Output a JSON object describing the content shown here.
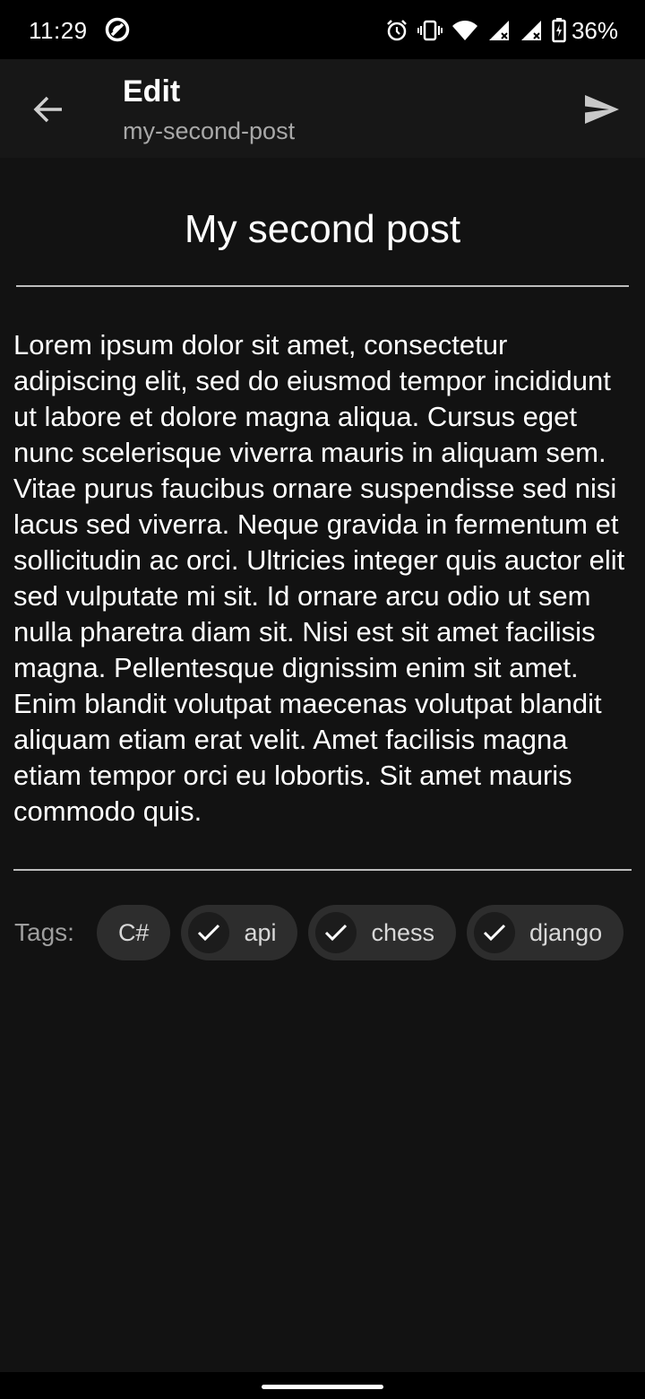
{
  "status_bar": {
    "time": "11:29",
    "battery": "36%",
    "icons": [
      "do-not-disturb-icon",
      "alarm-icon",
      "vibrate-icon",
      "wifi-icon",
      "signal-icon",
      "signal-icon",
      "battery-charging-icon"
    ]
  },
  "app_bar": {
    "title": "Edit",
    "subtitle": "my-second-post",
    "back_icon": "back-arrow-icon",
    "send_icon": "send-icon"
  },
  "post": {
    "title": "My second post",
    "body": "Lorem ipsum dolor sit amet, consectetur adipiscing elit, sed do eiusmod tempor incididunt ut labore et dolore magna aliqua. Cursus eget nunc scelerisque viverra mauris in aliquam sem. Vitae purus faucibus ornare suspendisse sed nisi lacus sed viverra. Neque gravida in fermentum et sollicitudin ac orci. Ultricies integer quis auctor elit sed vulputate mi sit. Id ornare arcu odio ut sem nulla pharetra diam sit. Nisi est sit amet facilisis magna. Pellentesque dignissim enim sit amet. Enim blandit volutpat maecenas volutpat blandit aliquam etiam erat velit. Amet facilisis magna etiam tempor orci eu lobortis. Sit amet mauris commodo quis."
  },
  "tags": {
    "label": "Tags:",
    "items": [
      {
        "label": "C#",
        "selected": false
      },
      {
        "label": "api",
        "selected": true
      },
      {
        "label": "chess",
        "selected": true
      },
      {
        "label": "django",
        "selected": true
      }
    ]
  },
  "colors": {
    "background": "#121212",
    "app_bar": "#171717",
    "chip": "#2d2d2d",
    "text": "#ffffff",
    "muted": "#9e9e9e"
  }
}
